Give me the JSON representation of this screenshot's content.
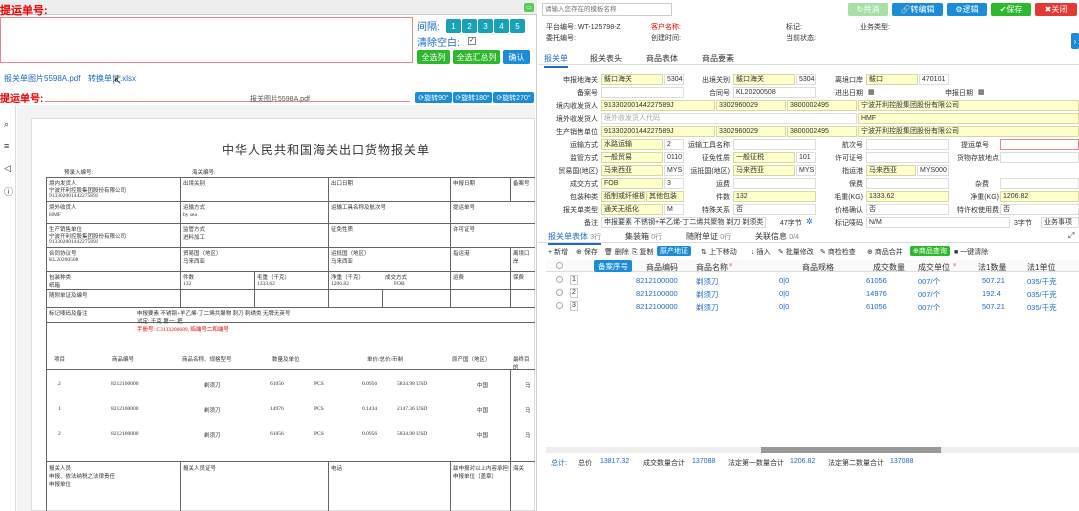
{
  "left": {
    "title": "提运单号:",
    "interval_label": "间隔:",
    "pages": [
      "1",
      "2",
      "3",
      "4",
      "5"
    ],
    "clear_label": "清除空白:",
    "buttons": {
      "all_stock": "全选列",
      "all_merge": "全选汇总列",
      "confirm": "确认"
    },
    "tabs": [
      "报关单图片5598A.pdf",
      "转换单证.xlsx"
    ],
    "sub_title": "提运单号:",
    "file_name": "报关图片5598A.pdf",
    "rotate": [
      "旋转90°",
      "旋转180°",
      "旋转270°"
    ],
    "doc": {
      "title": "中华人民共和国海关出口货物报关单",
      "prerecord": "预录入编号:",
      "customs_no": "海关编号:",
      "shipper_label": "境内发货人",
      "shipper": "宁波开利控股集团股份有限公司",
      "shipper_code": "91330200144227589J",
      "exit_port": "出境关别",
      "exit_date": "出口日期",
      "declare_date": "申报日期",
      "record_no": "备案号",
      "consignee_label": "境外收货人",
      "consignee": "HMF",
      "transport": "运输方式",
      "transport_val": "by sea",
      "vessel": "运输工具名称及航次号",
      "bill_no": "提运单号",
      "producer_label": "生产销售单位",
      "producer": "宁波开利控股集团股份有限公司",
      "producer_code": "91330200144227589J",
      "supervise": "监管方式",
      "supervise_val": "进料加工",
      "tax": "征免性质",
      "license": "许可证号",
      "contract_label": "合同协议号",
      "contract": "KL20200508",
      "trade_country": "贸易国（地区）",
      "trade_country_val": "马来西亚",
      "dest_country": "运抵国（地区）",
      "dest_country_val": "马来西亚",
      "port": "指运港",
      "depart_port": "离境口岸",
      "pack_label": "包装种类",
      "pack": "纸箱",
      "pieces_label": "件数",
      "pieces": "132",
      "gross_label": "毛重（千克）",
      "gross": "1333.62",
      "net_label": "净重（千克）",
      "net": "1206.82",
      "deal_label": "成交方式",
      "deal": "FOB",
      "freight": "运费",
      "insure": "保费",
      "docs_label": "随附单证及编号",
      "marks_label": "标记唛码及备注",
      "marks1": "申报要素 不锈钢+羊乙烯-丁二烯共聚物 刺刀 刺绣类 无牌无英号",
      "marks2": "试定: 千克 第一: 把",
      "marks3": "手册号: C3133200689, 临端号二和端号",
      "col_no": "项目",
      "col_code": "商品编号",
      "col_name": "商品名称、规格型号",
      "col_qty": "数量及单位",
      "col_price": "单价/总价/币制",
      "col_origin": "原产国（地区）",
      "col_dest": "最终目的",
      "rows": [
        {
          "no": "2",
          "code": "8212100000",
          "name": "剃须刀",
          "qty": "61056",
          "unit": "PCS",
          "price": "0.0956",
          "total": "5834.98 USD",
          "origin": "中国",
          "dest": "马"
        },
        {
          "no": "1",
          "code": "8212100000",
          "name": "剃须刀",
          "qty": "14976",
          "unit": "PCS",
          "price": "0.1434",
          "total": "2147.36 USD",
          "origin": "中国",
          "dest": "马"
        },
        {
          "no": "2",
          "code": "8212100000",
          "name": "剃须刀",
          "qty": "61056",
          "unit": "PCS",
          "price": "0.0956",
          "total": "5834.98 USD",
          "origin": "中国",
          "dest": "马"
        }
      ],
      "footer1": "报关人员",
      "footer2": "申报、依法纳税之法律责任",
      "footer3": "申报单位",
      "footer4": "报关人员证号",
      "footer5": "电话",
      "footer6": "兹申报对以上内容承担如实",
      "footer7": "申报单位（盖章）",
      "footer8": "海关"
    }
  },
  "right": {
    "search_placeholder": "请输入您存在的模板名称",
    "buttons": {
      "pass": "共消",
      "convert": "转编辑",
      "logic": "逻辑",
      "save": "保存",
      "close": "关闭"
    },
    "info": {
      "platform_label": "平台编号:",
      "platform": "WT-125798-Z",
      "customer_label": "客户名称:",
      "customer": "",
      "mark_label": "标记:",
      "business_label": "业务类型:",
      "entrust_label": "委托编号:",
      "create_label": "创建时间:",
      "status_label": "当前状态:"
    },
    "tabs": [
      "报关单",
      "报关表头",
      "商品表体",
      "商品要素"
    ],
    "form": {
      "declare_customs_l": "申报地海关",
      "declare_customs": "鲅口海关",
      "declare_customs_code": "5304",
      "exit_customs_l": "出境关别",
      "exit_customs": "鲅口海关",
      "exit_customs_code": "5304",
      "port_l": "离境口岸",
      "port": "鲅口",
      "port_code": "470101",
      "record_l": "备案号",
      "contract_l": "合同号",
      "contract": "KL20200508",
      "io_date_l": "进出日期",
      "declare_date_l": "申报日期",
      "shipper_l": "境内收发货人",
      "shipper_code": "91330200144227589J",
      "shipper_c2": "3302960029",
      "shipper_c3": "3800002495",
      "shipper": "宁波开利控股集团股份有限公司",
      "consignee_l": "境外收发货人",
      "consignee_ph": "境外收发货人代码",
      "consignee": "HMF",
      "producer_l": "生产销售单位",
      "producer_code": "91330200144227589J",
      "producer_c2": "3302960029",
      "producer_c3": "3800002495",
      "producer": "宁波开利控股集团股份有限公司",
      "transport_l": "运输方式",
      "transport": "水路运输",
      "transport_code": "2",
      "vessel_l": "运输工具名称",
      "voyage_l": "航次号",
      "bill_l": "提运单号",
      "supervise_l": "监管方式",
      "supervise": "一般贸易",
      "supervise_code": "0110",
      "tax_l": "征免性质",
      "tax": "一般征税",
      "tax_code": "101",
      "license_l": "许可证号",
      "cargo_l": "货物存放地点",
      "trade_l": "贸易国(地区)",
      "trade": "马来西亚",
      "trade_code": "MYS",
      "dest_l": "运抵国(地区)",
      "dest": "马来西亚",
      "dest_code": "MYS",
      "portto_l": "指运港",
      "portto": "马来西亚",
      "portto_code": "MYS000",
      "deal_l": "成交方式",
      "deal": "FOB",
      "deal_code": "3",
      "freight_l": "运费",
      "insure_l": "保费",
      "misc_l": "杂费",
      "pack_l": "包装种类",
      "pack": "纸制或纤维板制盒/箱",
      "pack2": "其他包装",
      "pieces_l": "件数",
      "pieces": "132",
      "gross_l": "毛重(KG)",
      "gross": "1333.62",
      "net_l": "净重(KG)",
      "net": "1206.82",
      "dtype_l": "报关单类型",
      "dtype": "通关无纸化",
      "dtype_code": "M",
      "special_l": "特殊关系",
      "special": "否",
      "price_l": "价格确认",
      "price": "否",
      "royalty_l": "特许权使用费",
      "royalty": "否",
      "remark_l": "备注",
      "remark": "申报要素 不锈钢+羊乙烯-丁二烯共聚物 剃刀 剃须类",
      "chars": "47字节",
      "mark_code_l": "标记唛码",
      "mark_code": "N/M",
      "mark_chars": "3字节",
      "business_item": "业务事项"
    },
    "sub_tabs": [
      {
        "label": "报关单表体",
        "count": "3行"
      },
      {
        "label": "集装箱",
        "count": "0行"
      },
      {
        "label": "随附单证",
        "count": "0行"
      },
      {
        "label": "关联信息",
        "count": "0/4"
      }
    ],
    "toolbar": [
      "新增",
      "保存",
      "删除",
      "复制",
      "原产地证",
      "上下移动",
      "插入",
      "批量修改",
      "商检检查",
      "商品合并",
      "商品查询",
      "一键清除"
    ],
    "cols": [
      "",
      "",
      "备案序号",
      "商品编码",
      "商品名称",
      "商品规格",
      "成交数量",
      "成交单位",
      "法1数量",
      "法1单位"
    ],
    "rows": [
      {
        "no": "1",
        "code": "8212100000",
        "name": "剃须刀",
        "spec": "0|0",
        "qty": "61056",
        "unit": "007/个",
        "q1": "507.21",
        "u1": "035/千克"
      },
      {
        "no": "2",
        "code": "8212100000",
        "name": "剃须刀",
        "spec": "0|0",
        "qty": "14976",
        "unit": "007/个",
        "q1": "192.4",
        "u1": "035/千克"
      },
      {
        "no": "3",
        "code": "8212100000",
        "name": "剃须刀",
        "spec": "0|0",
        "qty": "61056",
        "unit": "007/个",
        "q1": "507.21",
        "u1": "035/千克"
      }
    ],
    "summary": {
      "total_l": "总计:",
      "price_l": "总价",
      "price": "13817.32",
      "qty_l": "成交数量合计",
      "qty": "137088",
      "legal1_l": "法定第一数量合计",
      "legal1": "1206.82",
      "legal2_l": "法定第二数量合计",
      "legal2": "137088"
    }
  },
  "colors": {
    "accent": "#1a6bd1",
    "teal": "#17a2b8",
    "green": "#2eb82e",
    "red": "#e00000",
    "yellow": "#ffffcc"
  }
}
